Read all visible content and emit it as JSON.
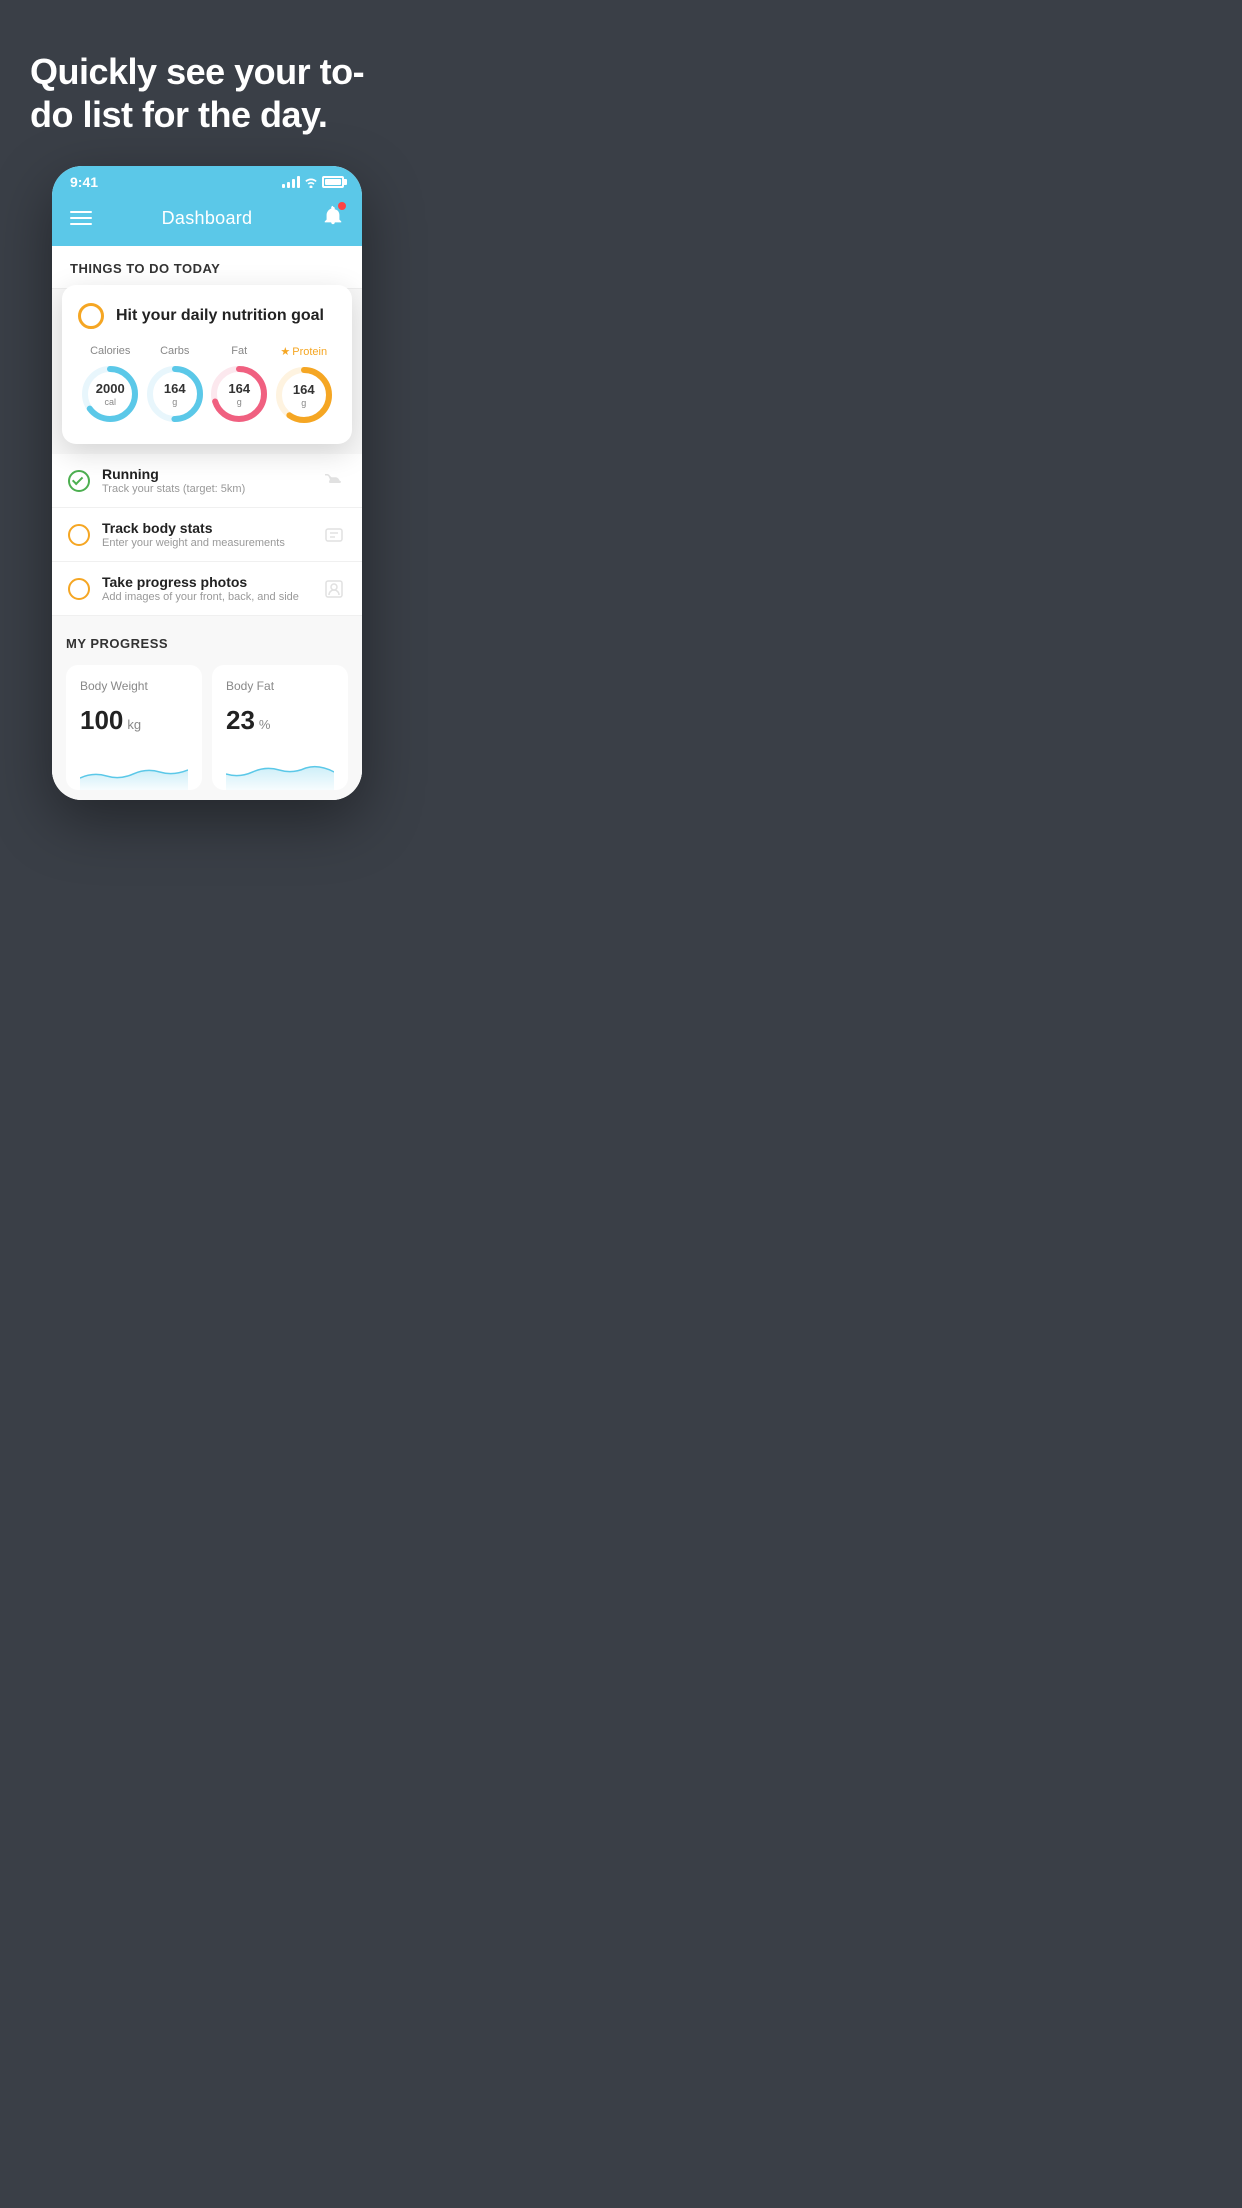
{
  "hero": {
    "title": "Quickly see your to-do list for the day."
  },
  "phone": {
    "status_bar": {
      "time": "9:41"
    },
    "header": {
      "title": "Dashboard"
    },
    "sections": {
      "things_to_do": {
        "title": "THINGS TO DO TODAY"
      }
    },
    "nutrition_card": {
      "title": "Hit your daily nutrition goal",
      "items": [
        {
          "label": "Calories",
          "value": "2000",
          "unit": "cal",
          "color": "#5bc8e8",
          "star": false,
          "progress": 65
        },
        {
          "label": "Carbs",
          "value": "164",
          "unit": "g",
          "color": "#5bc8e8",
          "star": false,
          "progress": 50
        },
        {
          "label": "Fat",
          "value": "164",
          "unit": "g",
          "color": "#f06080",
          "star": false,
          "progress": 70
        },
        {
          "label": "Protein",
          "value": "164",
          "unit": "g",
          "color": "#f5a623",
          "star": true,
          "progress": 60
        }
      ]
    },
    "todo_items": [
      {
        "id": "running",
        "title": "Running",
        "subtitle": "Track your stats (target: 5km)",
        "circle_color": "green",
        "checked": true,
        "icon": "shoe"
      },
      {
        "id": "track-body",
        "title": "Track body stats",
        "subtitle": "Enter your weight and measurements",
        "circle_color": "yellow",
        "checked": false,
        "icon": "scale"
      },
      {
        "id": "progress-photos",
        "title": "Take progress photos",
        "subtitle": "Add images of your front, back, and side",
        "circle_color": "yellow",
        "checked": false,
        "icon": "person"
      }
    ],
    "my_progress": {
      "title": "MY PROGRESS",
      "cards": [
        {
          "id": "body-weight",
          "title": "Body Weight",
          "value": "100",
          "unit": "kg"
        },
        {
          "id": "body-fat",
          "title": "Body Fat",
          "value": "23",
          "unit": "%"
        }
      ]
    }
  }
}
